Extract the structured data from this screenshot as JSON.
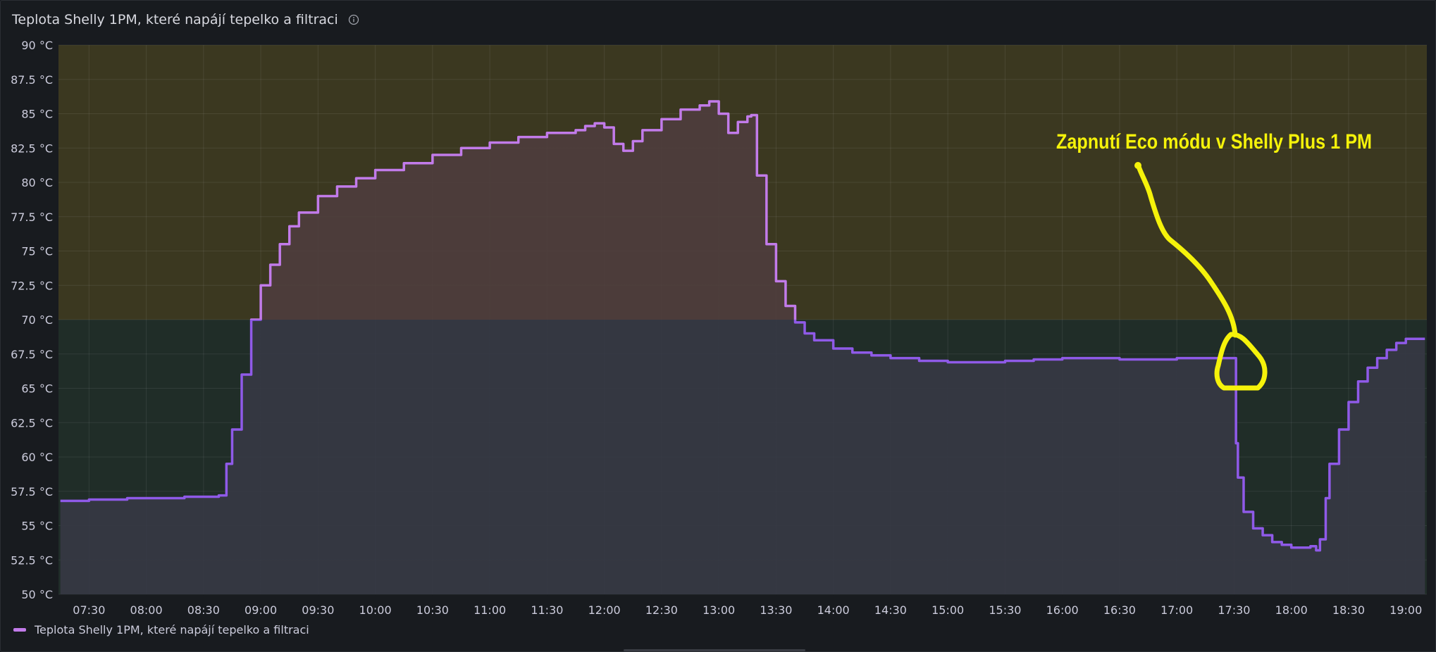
{
  "panel": {
    "title": "Teplota Shelly 1PM, které napájí tepelko a filtraci",
    "info_icon": "info-circle-icon"
  },
  "legend": {
    "label": "Teplota Shelly 1PM, které napájí tepelko a filtraci"
  },
  "annotation": {
    "text": "Zapnutí Eco módu v Shelly Plus 1 PM",
    "color": "#f5f20a"
  },
  "colors": {
    "background": "#181b1f",
    "line": "#c27bea",
    "line_low": "#8f5ae8",
    "threshold_high": "#3b3820",
    "threshold_low": "#202d28",
    "fill_high": "#4e3d3d",
    "fill_low": "#363844"
  },
  "chart_data": {
    "type": "line",
    "series": [
      {
        "name": "Teplota Shelly 1PM, které napájí tepelko a filtraci",
        "x": [
          "07:15",
          "07:20",
          "07:30",
          "07:40",
          "07:50",
          "08:00",
          "08:10",
          "08:20",
          "08:30",
          "08:35",
          "08:38",
          "08:42",
          "08:45",
          "08:50",
          "08:55",
          "09:00",
          "09:05",
          "09:10",
          "09:15",
          "09:20",
          "09:30",
          "09:40",
          "09:50",
          "10:00",
          "10:15",
          "10:30",
          "10:45",
          "11:00",
          "11:15",
          "11:30",
          "11:45",
          "11:50",
          "11:55",
          "12:00",
          "12:05",
          "12:10",
          "12:15",
          "12:20",
          "12:30",
          "12:40",
          "12:50",
          "12:55",
          "13:00",
          "13:05",
          "13:10",
          "13:15",
          "13:17",
          "13:20",
          "13:25",
          "13:30",
          "13:35",
          "13:40",
          "13:45",
          "13:50",
          "14:00",
          "14:10",
          "14:20",
          "14:30",
          "14:45",
          "15:00",
          "15:15",
          "15:30",
          "15:45",
          "16:00",
          "16:15",
          "16:30",
          "16:45",
          "17:00",
          "17:15",
          "17:25",
          "17:30",
          "17:31",
          "17:32",
          "17:35",
          "17:40",
          "17:45",
          "17:50",
          "17:55",
          "18:00",
          "18:05",
          "18:10",
          "18:13",
          "18:15",
          "18:18",
          "18:20",
          "18:25",
          "18:30",
          "18:35",
          "18:40",
          "18:45",
          "18:50",
          "18:55",
          "19:00",
          "19:05",
          "19:10"
        ],
        "y": [
          56.8,
          56.8,
          56.9,
          56.9,
          57.0,
          57.0,
          57.0,
          57.1,
          57.1,
          57.1,
          57.2,
          59.5,
          62.0,
          66.0,
          70.0,
          72.5,
          74.0,
          75.5,
          76.8,
          77.8,
          79.0,
          79.7,
          80.3,
          80.9,
          81.4,
          82.0,
          82.5,
          82.9,
          83.3,
          83.6,
          83.8,
          84.1,
          84.3,
          84.0,
          82.8,
          82.3,
          83.0,
          83.8,
          84.6,
          85.3,
          85.6,
          85.9,
          85.0,
          83.6,
          84.4,
          84.8,
          84.9,
          80.5,
          75.5,
          72.8,
          71.0,
          69.8,
          69.0,
          68.5,
          67.9,
          67.6,
          67.4,
          67.2,
          67.0,
          66.9,
          66.9,
          67.0,
          67.1,
          67.2,
          67.2,
          67.1,
          67.1,
          67.2,
          67.2,
          67.2,
          67.2,
          61.0,
          58.5,
          56.0,
          54.8,
          54.3,
          53.8,
          53.6,
          53.4,
          53.4,
          53.5,
          53.2,
          54.0,
          57.0,
          59.5,
          62.0,
          64.0,
          65.5,
          66.5,
          67.2,
          67.8,
          68.3,
          68.6,
          68.6,
          68.6
        ]
      }
    ],
    "xlim": [
      "07:14",
      "19:11"
    ],
    "ylim": [
      50,
      90
    ],
    "x_ticks": [
      "07:30",
      "08:00",
      "08:30",
      "09:00",
      "09:30",
      "10:00",
      "10:30",
      "11:00",
      "11:30",
      "12:00",
      "12:30",
      "13:00",
      "13:30",
      "14:00",
      "14:30",
      "15:00",
      "15:30",
      "16:00",
      "16:30",
      "17:00",
      "17:30",
      "18:00",
      "18:30",
      "19:00"
    ],
    "y_ticks": [
      {
        "value": 50,
        "label": "50 °C"
      },
      {
        "value": 52.5,
        "label": "52.5 °C"
      },
      {
        "value": 55,
        "label": "55 °C"
      },
      {
        "value": 57.5,
        "label": "57.5 °C"
      },
      {
        "value": 60,
        "label": "60 °C"
      },
      {
        "value": 62.5,
        "label": "62.5 °C"
      },
      {
        "value": 65,
        "label": "65 °C"
      },
      {
        "value": 67.5,
        "label": "67.5 °C"
      },
      {
        "value": 70,
        "label": "70 °C"
      },
      {
        "value": 72.5,
        "label": "72.5 °C"
      },
      {
        "value": 75,
        "label": "75 °C"
      },
      {
        "value": 77.5,
        "label": "77.5 °C"
      },
      {
        "value": 80,
        "label": "80 °C"
      },
      {
        "value": 82.5,
        "label": "82.5 °C"
      },
      {
        "value": 85,
        "label": "85 °C"
      },
      {
        "value": 87.5,
        "label": "87.5 °C"
      },
      {
        "value": 90,
        "label": "90 °C"
      }
    ],
    "threshold": 70,
    "grid": true,
    "legend": "bottom-left"
  }
}
